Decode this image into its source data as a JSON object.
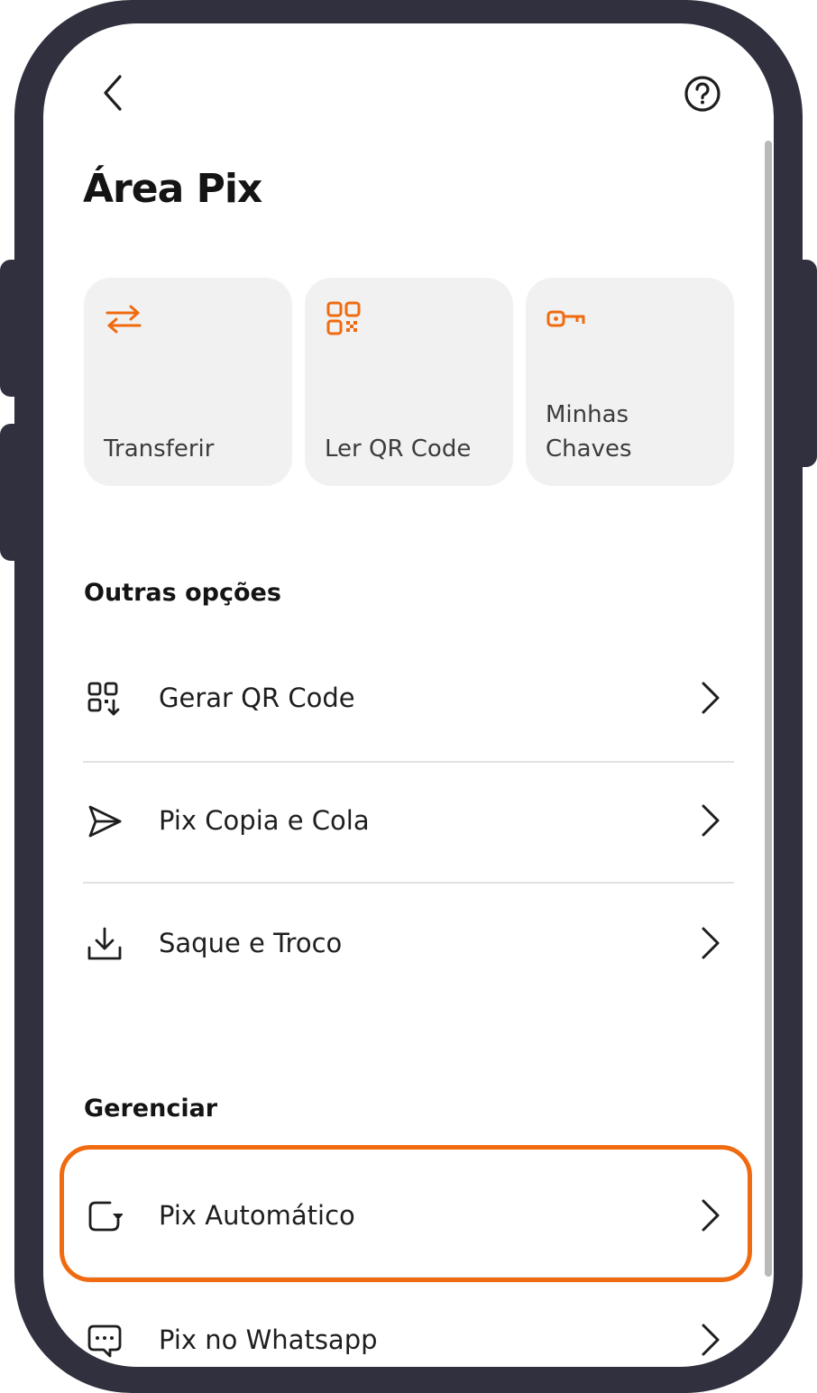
{
  "header": {
    "back_icon": "chevron-left-icon",
    "help_icon": "question-circle-icon",
    "title": "Área Pix"
  },
  "quick_actions": [
    {
      "label": "Transferir",
      "icon": "transfer-arrows-icon"
    },
    {
      "label": "Ler QR Code",
      "icon": "qr-code-icon"
    },
    {
      "label": "Minhas\nChaves",
      "icon": "key-icon"
    }
  ],
  "other_options": {
    "title": "Outras opções",
    "items": [
      {
        "label": "Gerar QR Code",
        "icon": "qr-code-download-icon"
      },
      {
        "label": "Pix Copia e Cola",
        "icon": "send-icon"
      },
      {
        "label": "Saque e Troco",
        "icon": "download-icon"
      }
    ]
  },
  "manage": {
    "title": "Gerenciar",
    "items": [
      {
        "label": "Pix Automático",
        "icon": "recurring-icon",
        "highlighted": true
      },
      {
        "label": "Pix no Whatsapp",
        "icon": "chat-icon"
      }
    ]
  },
  "colors": {
    "accent": "#f06a10",
    "frame": "#30303f",
    "card_bg": "#f1f1f1",
    "text": "#141414"
  }
}
